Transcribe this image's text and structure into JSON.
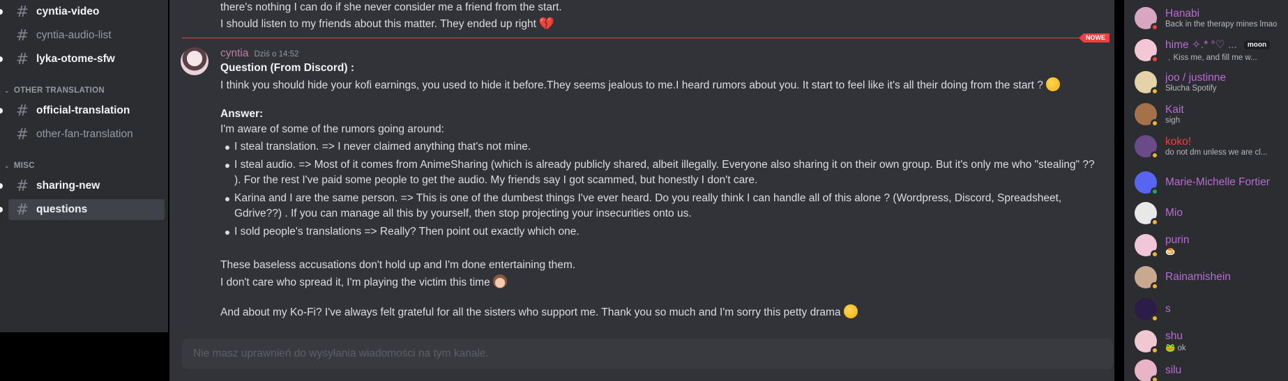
{
  "sidebar": {
    "channels": [
      {
        "label": "cyntia-video",
        "unread": true
      },
      {
        "label": "cyntia-audio-list",
        "unread": false
      },
      {
        "label": "lyka-otome-sfw",
        "unread": true
      },
      {
        "label": "official-translation",
        "unread": true
      },
      {
        "label": "other-fan-translation",
        "unread": false
      },
      {
        "label": "sharing-new",
        "unread": true
      },
      {
        "label": "questions",
        "unread": true,
        "selected": true
      }
    ],
    "categories": [
      "OTHER TRANSLATION",
      "MISC"
    ]
  },
  "chat": {
    "previous_lines": [
      "there's nothing I can do if she never consider me a friend from the start.",
      "I should listen to my friends about this matter. They ended up right"
    ],
    "new_badge": "NOWE",
    "message": {
      "author": "cyntia",
      "timestamp": "Dziś o 14:52",
      "question_title": "Question (From Discord) :",
      "question": "I think you should hide your kofi earnings, you used to hide it before.They seems jealous to me.I heard rumors about you. It start to feel like it's all their doing from the start ?",
      "answer_title": "Answer:",
      "answer_intro": "I'm aware of some of the rumors going around:",
      "bullets": [
        {
          "lines": [
            "I steal translation. => I never claimed anything that's not mine."
          ]
        },
        {
          "lines": [
            "I steal audio. => Most of it comes from AnimeSharing (which is already publicly shared, albeit illegally. Everyone also sharing it on their own group. But it's only me who \"stealing\" ??",
            "). For the rest I've paid some people to get the audio. My friends say I got scammed, but honestly I don't care."
          ]
        },
        {
          "lines": [
            "Karina and I are the same person. => This is one of the dumbest things I've ever heard. Do you really think I can handle all of this alone ? (Wordpress, Discord, Spreadsheet,",
            "Gdrive??) . If you can manage all this by yourself, then stop projecting your insecurities onto us."
          ]
        },
        {
          "lines": [
            "I sold people's translations => Really? Then point out exactly which one."
          ]
        }
      ],
      "closing_1": "These baseless accusations don't hold up and I'm done entertaining them.",
      "closing_2": "I don't care who spread it, I'm playing the victim this time",
      "closing_3": "And about my Ko-Fi? I've always felt grateful for all the sisters who support me. Thank you so much and I'm sorry this petty drama"
    },
    "input_placeholder": "Nie masz uprawnień do wysyłania wiadomości na tym kanale."
  },
  "members": [
    {
      "name": "Hanabi",
      "sub": "Back in the therapy mines lmao",
      "status": "dnd",
      "name_color": "purple",
      "avatar_color": "#d7a6c0"
    },
    {
      "name": "hime ✧.* °♡ ...",
      "sub": "﹒Kiss me, and fill me w...",
      "status": "dnd",
      "name_color": "purple",
      "tag": "moon",
      "avatar_color": "#f3c7d6"
    },
    {
      "name": "joo / justinne",
      "sub": "Słucha Spotify",
      "status": "idle",
      "name_color": "purple",
      "avatar_color": "#e6d2a8"
    },
    {
      "name": "Kait",
      "sub": "sigh",
      "status": "idle",
      "name_color": "purple",
      "avatar_color": "#a47149"
    },
    {
      "name": "koko!",
      "sub": "do not dm unless we are cl...",
      "status": "idle",
      "name_color": "red",
      "avatar_color": "#6b4a8a"
    },
    {
      "name": "Marie-Michelle Fortier",
      "sub": "",
      "status": "online",
      "name_color": "purple",
      "avatar_color": "#5865f2"
    },
    {
      "name": "Mio",
      "sub": "",
      "status": "idle",
      "name_color": "purple",
      "avatar_color": "#e8e8e8"
    },
    {
      "name": "purin",
      "sub": "🍮",
      "status": "idle",
      "name_color": "purple",
      "avatar_color": "#f1c6d8"
    },
    {
      "name": "Rainamishein",
      "sub": "",
      "status": "idle",
      "name_color": "purple",
      "avatar_color": "#c9a88f"
    },
    {
      "name": "s",
      "sub": "",
      "status": "idle",
      "name_color": "purple",
      "avatar_color": "#2b1c4a"
    },
    {
      "name": "shu",
      "sub": "🐸 ok",
      "status": "idle",
      "name_color": "purple",
      "avatar_color": "#f0c8d4"
    },
    {
      "name": "silu",
      "sub": "",
      "status": "idle",
      "name_color": "purple",
      "avatar_color": "#e9b4c6"
    }
  ]
}
